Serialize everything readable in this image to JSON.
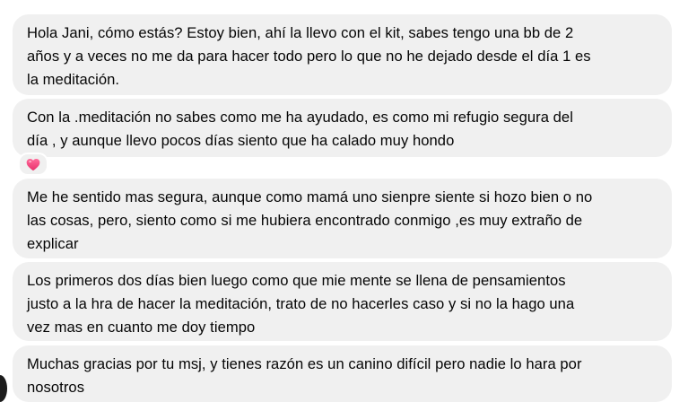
{
  "messages": [
    {
      "lines": [
        "Hola Jani, cómo estás? Estoy bien, ahí la llevo con el kit, sabes tengo una bb de 2",
        "años y a veces no me da para hacer todo pero lo que no he dejado desde el día 1 es",
        "la meditación."
      ]
    },
    {
      "lines": [
        "Con la .meditación no sabes como me ha ayudado,  es como mi refugio segura del",
        "día , y aunque llevo pocos días siento que ha calado muy hondo"
      ],
      "reaction": "heart-icon"
    },
    {
      "lines": [
        "Me he sentido mas segura, aunque como mamá uno sienpre siente si hozo bien o no",
        "las cosas, pero, siento como si me hubiera encontrado conmigo ,es muy extraño de",
        "explicar"
      ]
    },
    {
      "lines": [
        "Los primeros dos días bien luego como que mie mente se llena de pensamientos",
        "justo a la hra de hacer la meditación,  trato de no hacerles caso y si no la hago una",
        "vez mas en cuanto me doy tiempo"
      ]
    },
    {
      "lines": [
        "Muchas gracias por tu msj, y tienes razón es un canino difícil pero nadie lo hara por",
        "nosotros"
      ]
    }
  ],
  "colors": {
    "bubble_background": "#f0f0f0",
    "text": "#050505",
    "reaction_heart": "#f2548c"
  }
}
